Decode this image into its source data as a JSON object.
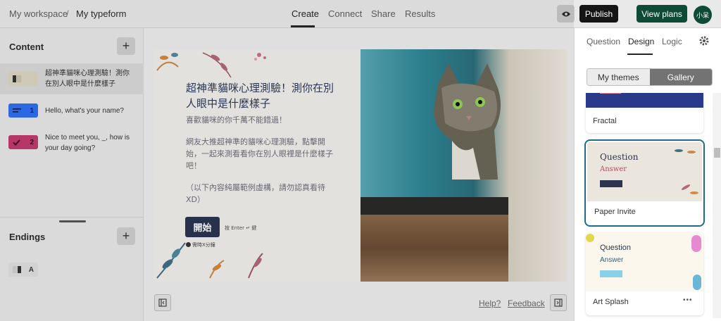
{
  "header": {
    "breadcrumb_workspace": "My workspace",
    "breadcrumb_sep": "/",
    "breadcrumb_form": "My typeform",
    "tabs": [
      "Create",
      "Connect",
      "Share",
      "Results"
    ],
    "publish_label": "Publish",
    "viewplans_label": "View plans",
    "avatar_label": "小呆"
  },
  "sidebar": {
    "content_title": "Content",
    "endings_title": "Endings",
    "add": "+",
    "items": [
      {
        "label": "超神準貓咪心理測驗！測你在別人眼中是什麼樣子",
        "number": ""
      },
      {
        "label": "Hello, what's your name?",
        "number": "1"
      },
      {
        "label": "Nice to meet you, _, how is your day going?",
        "number": "2"
      }
    ],
    "ending_letter": "A"
  },
  "form": {
    "title": "超神準貓咪心理測驗！測你在別人眼中是什麼樣子",
    "desc1": "喜歡貓咪的你千萬不能錯過！",
    "desc2": "網友大推超神準的貓咪心理測驗，點擊開始，一起來測看看你在別人眼裡是什麼樣子吧！",
    "desc3": "（以下內容純屬範例虛構，請勿認真看待 XD）",
    "start_label": "開始",
    "enter_hint": "按 Enter ↵ 鍵",
    "time_hint": "需時X分鐘"
  },
  "bottom": {
    "help": "Help?",
    "feedback": "Feedback"
  },
  "right": {
    "tabs": [
      "Question",
      "Design",
      "Logic"
    ],
    "seg_mythemes": "My themes",
    "seg_gallery": "Gallery",
    "themes": [
      {
        "name": "Fractal"
      },
      {
        "name": "Paper Invite",
        "q": "Question",
        "a": "Answer"
      },
      {
        "name": "Art Splash",
        "q": "Question",
        "a": "Answer",
        "more": "•••"
      }
    ]
  },
  "colors": {
    "publish_bg": "#151515",
    "viewplans_bg": "#0f4a36",
    "badge_blue": "#2f6ff0",
    "badge_pink": "#c23a6e",
    "start_bg": "#2b3550",
    "selected_ring": "#1b6d8a"
  }
}
